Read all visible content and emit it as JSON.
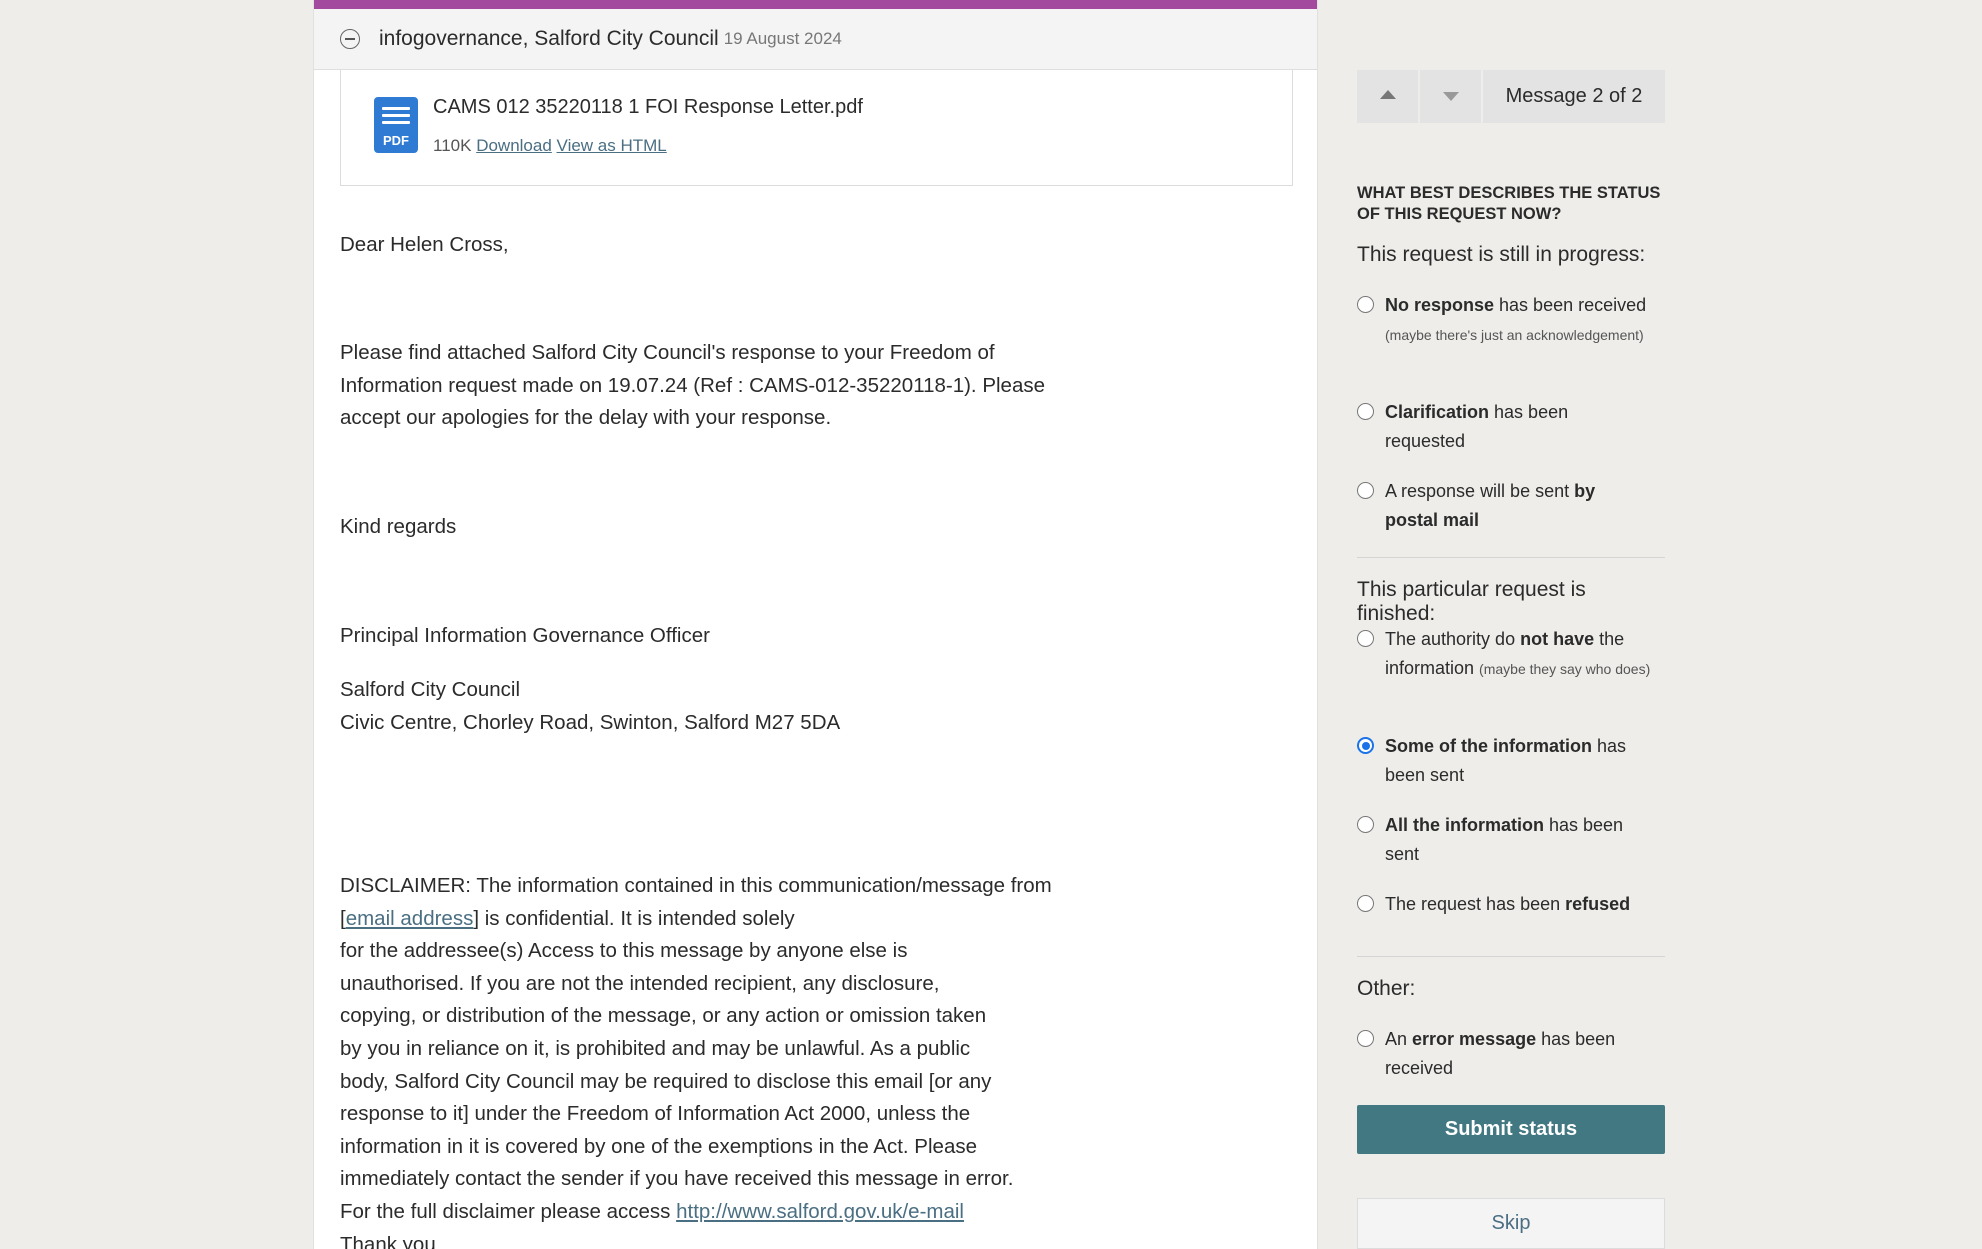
{
  "message": {
    "sender": "infogovernance, Salford City Council",
    "date": "19 August 2024",
    "attachment": {
      "name": "CAMS 012 35220118 1 FOI Response Letter.pdf",
      "size": "110K",
      "download_label": "Download",
      "view_html_label": "View as HTML",
      "icon_label": "PDF"
    },
    "body": {
      "greeting": "Dear Helen Cross,",
      "para1": "Please find attached Salford City Council's response to your Freedom of\nInformation request made on 19.07.24 (Ref : CAMS-012-35220118-1). Please\naccept our apologies for the delay with your response.",
      "regards": "Kind regards",
      "title": "Principal Information Governance Officer",
      "address": "Salford City Council\nCivic Centre, Chorley Road, Swinton, Salford M27 5DA",
      "disclaimer_line1": "DISCLAIMER: The information contained in this communication/message from",
      "disclaimer_bracket_open": "[",
      "disclaimer_email_link": "email address",
      "disclaimer_after_link": "] is confidential. It is intended solely",
      "disclaimer_rest": "for the addressee(s) Access to this message by anyone else is\nunauthorised. If you are not the intended recipient, any disclosure,\ncopying, or distribution of the message, or any action or omission taken\nby you in reliance on it, is prohibited and may be unlawful. As a public\nbody, Salford City Council may be required to disclose this email [or any\nresponse to it] under the Freedom of Information Act 2000, unless the\ninformation in it is covered by one of the exemptions in the Act. Please\nimmediately contact the sender if you have received this message in error.",
      "disclaimer_access_prefix": "For the full disclaimer please access ",
      "disclaimer_url": "http://www.salford.gov.uk/e-mail",
      "thanks": "Thank you"
    }
  },
  "sidebar": {
    "message_counter": "Message 2 of 2",
    "question": "What best describes the status of this request now?",
    "in_progress_title": "This request is still in progress:",
    "finished_title": "This particular request is finished:",
    "other_title": "Other:",
    "options": {
      "no_response": {
        "bold": "No response",
        "rest": " has been received ",
        "small": "(maybe there's just an acknowledgement)"
      },
      "clarification": {
        "bold": "Clarification",
        "rest": " has been requested"
      },
      "postal": {
        "pre": "A response will be sent ",
        "bold": "by postal mail"
      },
      "not_held": {
        "pre": "The authority do ",
        "bold": "not have",
        "rest": " the information ",
        "small": "(maybe they say who does)"
      },
      "partial": {
        "bold": "Some of the information",
        "rest": " has been sent",
        "checked": true
      },
      "all": {
        "bold": "All the information",
        "rest": " has been sent"
      },
      "refused": {
        "pre": "The request has been ",
        "bold": "refused"
      },
      "error": {
        "pre": "An ",
        "bold": "error message",
        "rest": " has been received"
      }
    },
    "submit_label": "Submit status",
    "skip_label": "Skip"
  },
  "colors": {
    "header_bar": "#a44a9e",
    "submit_button": "#417882",
    "link": "#4a6e82",
    "radio_checked": "#1a73e8",
    "pdf_icon": "#2f7bd4"
  }
}
